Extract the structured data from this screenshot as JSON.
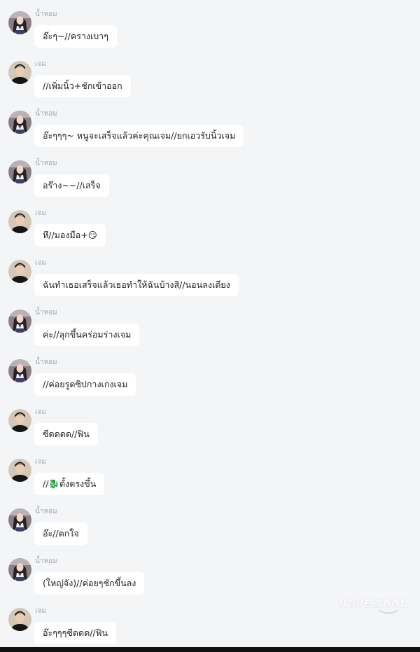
{
  "watermark": "NOVELTOON",
  "colors": {
    "background": "#f4f5f7",
    "bubble": "#ffffff",
    "sender_name": "#a3a7ad",
    "text": "#222222"
  },
  "messages": [
    {
      "sender": "น้ำหอม",
      "avatar": "girl-avatar",
      "text": "อ๊ะๆ~//ครางเบาๆ"
    },
    {
      "sender": "เจม",
      "avatar": "boy-avatar",
      "text": "//เพิ่มนิ้ว+ชักเข้าออก"
    },
    {
      "sender": "น้ำหอม",
      "avatar": "girl-avatar",
      "text": "อ๊ะๆๆๆ~ หนูจะเสร็จแล้วค่ะคุณเจม//ยกเอวรับนิ้วเจม"
    },
    {
      "sender": "น้ำหอม",
      "avatar": "girl-avatar",
      "text": "อร๊าง~~//เสร็จ"
    },
    {
      "sender": "เจม",
      "avatar": "boy-avatar",
      "text": "หึ//มองมือ+😏"
    },
    {
      "sender": "เจม",
      "avatar": "boy-avatar",
      "text": "ฉันทำเธอเสร็จแล้วเธอทำให้ฉันบ้างสิ//นอนลงเตียง"
    },
    {
      "sender": "น้ำหอม",
      "avatar": "girl-avatar",
      "text": "ค่ะ//ลุกขึ้นคร่อมร่างเจม"
    },
    {
      "sender": "น้ำหอม",
      "avatar": "girl-avatar",
      "text": "//ค่อยรูดซิปกางเกงเจม"
    },
    {
      "sender": "เจม",
      "avatar": "boy-avatar",
      "text": "ซีดดดด//ฟิน"
    },
    {
      "sender": "เจม",
      "avatar": "boy-avatar",
      "text": "//🐉ตั้งตรงขึ้น"
    },
    {
      "sender": "น้ำหอม",
      "avatar": "girl-avatar",
      "text": "อ๊ะ//ตกใจ"
    },
    {
      "sender": "น้ำหอม",
      "avatar": "girl-avatar",
      "text": "(ใหญ่จัง)//ค่อยๆชักขึ้นลง"
    },
    {
      "sender": "เจม",
      "avatar": "boy-avatar",
      "text": "อ๊ะๆๆๆซีดดด//ฟิน"
    }
  ]
}
